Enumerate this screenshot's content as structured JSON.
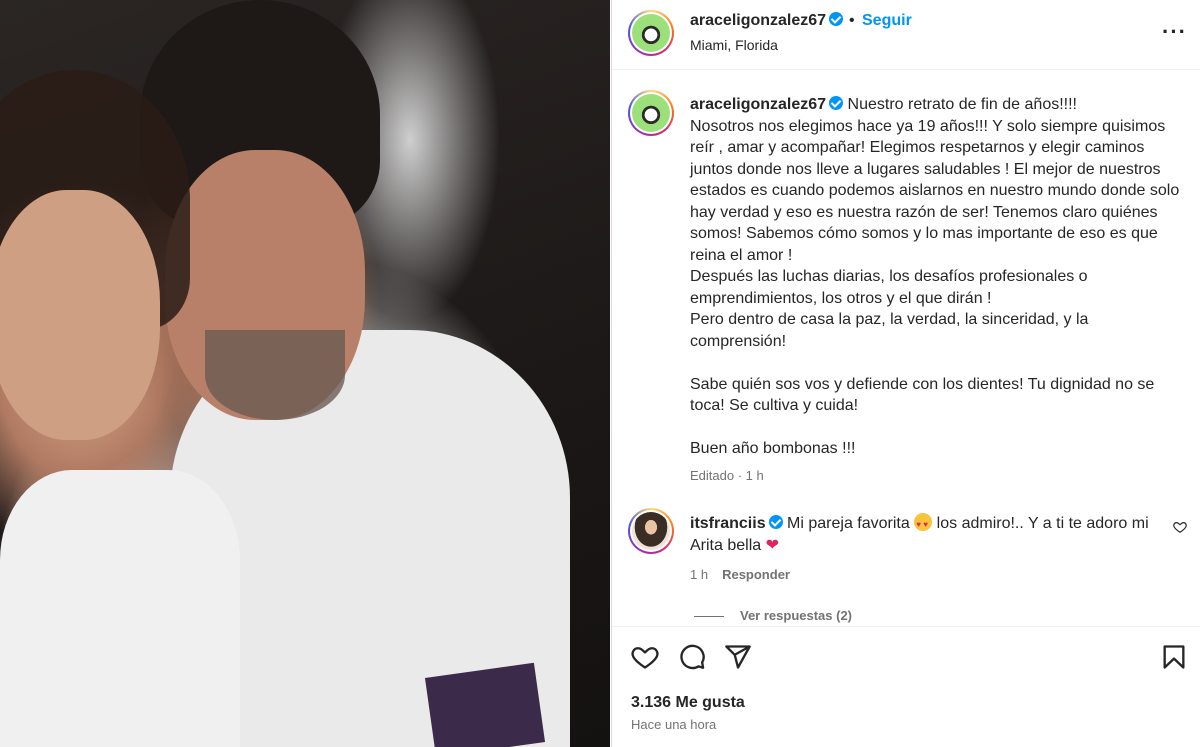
{
  "post": {
    "username": "araceligonzalez67",
    "location": "Miami, Florida",
    "follow_label": "Seguir",
    "dot": "•",
    "more_label": "···"
  },
  "caption": {
    "username": "araceligonzalez67",
    "lines": [
      "Nuestro retrato de fin de años!!!!",
      "Nosotros nos elegimos hace ya 19 años!!! Y solo siempre quisimos reír , amar y acompañar! Elegimos respetarnos y elegir caminos juntos donde nos lleve a lugares saludables ! El mejor de nuestros estados es cuando podemos aislarnos en nuestro mundo donde solo hay verdad y eso es nuestra razón de ser! Tenemos claro quiénes somos! Sabemos cómo somos y lo mas importante de eso es que reina el amor !",
      "Después las luchas diarias, los desafíos profesionales o emprendimientos, los otros y el que dirán !",
      "Pero dentro de casa la paz, la verdad, la sinceridad, y la comprensión!",
      "Sabe quién sos vos y defiende con los dientes! Tu dignidad no se toca! Se cultiva y cuida!",
      "Buen año bombonas !!!"
    ],
    "edited": "Editado",
    "edited_dot": " · ",
    "time": "1 h"
  },
  "comment": {
    "username": "itsfranciis",
    "text_part1": "Mi pareja favorita",
    "text_part2": "los admiro!.. Y a ti te adoro mi Arita bella",
    "heart_emoji": "❤",
    "time": "1 h",
    "reply_label": "Responder",
    "view_replies": "Ver respuestas (2)"
  },
  "actions": {
    "likes": "3.136 Me gusta",
    "time_ago": "Hace una hora"
  },
  "icons": [
    "verified-badge-icon",
    "more-options-icon",
    "like-heart-icon",
    "comment-icon",
    "share-icon",
    "save-bookmark-icon",
    "comment-like-icon"
  ]
}
